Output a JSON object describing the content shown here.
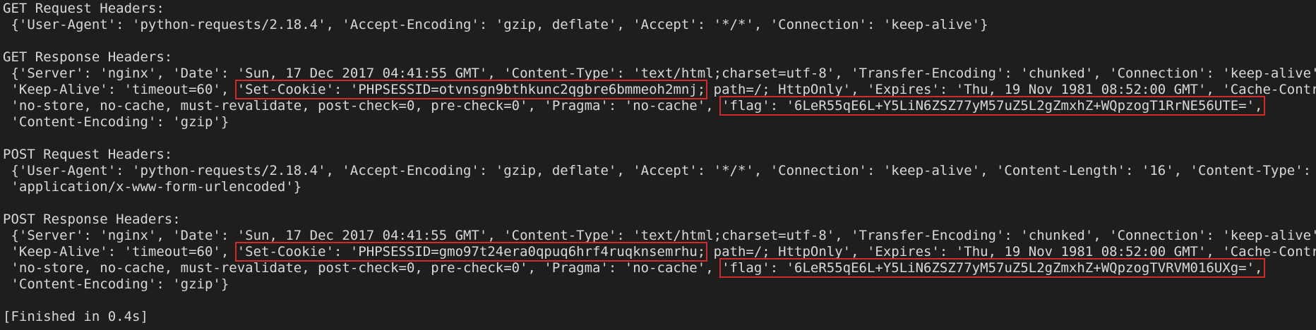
{
  "console": {
    "get_request": {
      "header": "GET Request Headers:",
      "line1": " {'User-Agent': 'python-requests/2.18.4', 'Accept-Encoding': 'gzip, deflate', 'Accept': '*/*', 'Connection': 'keep-alive'}"
    },
    "get_response": {
      "header": "GET Response Headers:",
      "line1": " {'Server': 'nginx', 'Date': 'Sun, 17 Dec 2017 04:41:55 GMT', 'Content-Type': 'text/html;charset=utf-8', 'Transfer-Encoding': 'chunked', 'Connection': 'keep-alive',",
      "line2_pre": " 'Keep-Alive': 'timeout=60', ",
      "line2_cookie": "'Set-Cookie': 'PHPSESSID=otvnsgn9bthkunc2qgbre6bmmeoh2mnj;",
      "line2_post": " path=/; HttpOnly', 'Expires': 'Thu, 19 Nov 1981 08:52:00 GMT', 'Cache-Control':",
      "line3_pre": " 'no-store, no-cache, must-revalidate, post-check=0, pre-check=0', 'Pragma': 'no-cache', ",
      "line3_flag": "'flag': '6LeR55qE6L+Y5LiN6ZSZ77yM57uZ5L2gZmxhZ+WQpzogT1RrNE56UTE=',",
      "line4": " 'Content-Encoding': 'gzip'}"
    },
    "post_request": {
      "header": "POST Request Headers:",
      "line1": " {'User-Agent': 'python-requests/2.18.4', 'Accept-Encoding': 'gzip, deflate', 'Accept': '*/*', 'Connection': 'keep-alive', 'Content-Length': '16', 'Content-Type':",
      "line2": " 'application/x-www-form-urlencoded'}"
    },
    "post_response": {
      "header": "POST Response Headers:",
      "line1": " {'Server': 'nginx', 'Date': 'Sun, 17 Dec 2017 04:41:55 GMT', 'Content-Type': 'text/html;charset=utf-8', 'Transfer-Encoding': 'chunked', 'Connection': 'keep-alive',",
      "line2_pre": " 'Keep-Alive': 'timeout=60', ",
      "line2_cookie": "'Set-Cookie': 'PHPSESSID=gmo97t24era0qpuq6hrf4ruqknsemrhu;",
      "line2_post": " path=/; HttpOnly', 'Expires': 'Thu, 19 Nov 1981 08:52:00 GMT', 'Cache-Control':",
      "line3_pre": " 'no-store, no-cache, must-revalidate, post-check=0, pre-check=0', 'Pragma': 'no-cache', ",
      "line3_flag": "'flag': '6LeR55qE6L+Y5LiN6ZSZ77yM57uZ5L2gZmxhZ+WQpzogTVRVM016UXg=',",
      "line4": " 'Content-Encoding': 'gzip'}"
    },
    "status": "[Finished in 0.4s]",
    "colors": {
      "background": "#1e1e1e",
      "text": "#d8d8d8",
      "highlight_box": "#d22b2b"
    }
  }
}
